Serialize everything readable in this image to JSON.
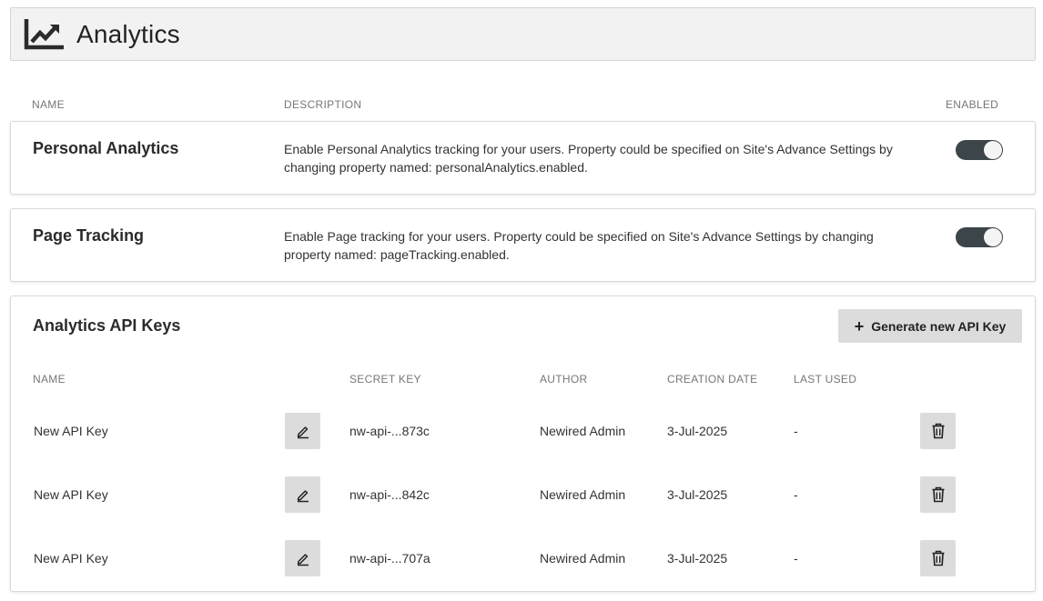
{
  "header": {
    "title": "Analytics",
    "icon": "chart-line-icon"
  },
  "columns": {
    "name": "NAME",
    "description": "DESCRIPTION",
    "enabled": "ENABLED"
  },
  "settings": [
    {
      "name": "Personal Analytics",
      "description": "Enable Personal Analytics tracking for your users. Property could be specified on Site's Advance Settings by changing property named: personalAnalytics.enabled.",
      "enabled": true
    },
    {
      "name": "Page Tracking",
      "description": "Enable Page tracking for your users. Property could be specified on Site's Advance Settings by changing property named: pageTracking.enabled.",
      "enabled": true
    }
  ],
  "api_keys": {
    "title": "Analytics API Keys",
    "generate_label": "Generate new API Key",
    "columns": {
      "name": "NAME",
      "secret": "SECRET KEY",
      "author": "AUTHOR",
      "created": "CREATION DATE",
      "last_used": "LAST USED"
    },
    "rows": [
      {
        "name": "New API Key",
        "secret": "nw-api-...873c",
        "author": "Newired Admin",
        "created": "3-Jul-2025",
        "last_used": "-"
      },
      {
        "name": "New API Key",
        "secret": "nw-api-...842c",
        "author": "Newired Admin",
        "created": "3-Jul-2025",
        "last_used": "-"
      },
      {
        "name": "New API Key",
        "secret": "nw-api-...707a",
        "author": "Newired Admin",
        "created": "3-Jul-2025",
        "last_used": "-"
      }
    ]
  },
  "colors": {
    "toggle_on": "#3c4549",
    "button_bg": "#dcdcdc",
    "header_bg": "#f2f2f2"
  }
}
